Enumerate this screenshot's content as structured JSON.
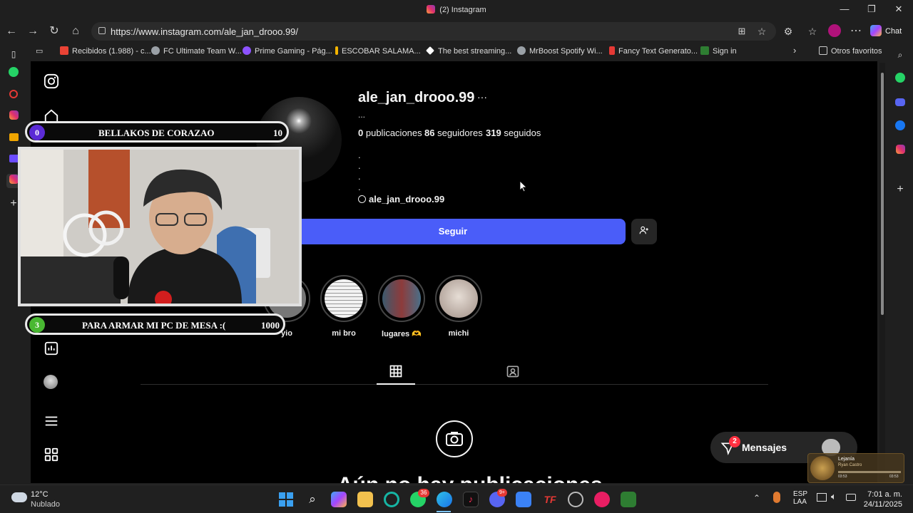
{
  "window": {
    "title": "(2) Instagram",
    "minimize": "—",
    "maximize": "❐",
    "close": "✕"
  },
  "browser": {
    "url": "https://www.instagram.com/ale_jan_drooo.99/",
    "chat_label": "Chat",
    "favorites_label": "Otros favoritos",
    "bookmarks": [
      {
        "label": "Recibidos (1.988) - c...",
        "color": "#ea4335"
      },
      {
        "label": "FC Ultimate Team W...",
        "color": "#9aa0a6"
      },
      {
        "label": "Prime Gaming - Pág...",
        "color": "#8c52ff"
      },
      {
        "label": "ESCOBAR SALAMA...",
        "color": "#f4b400"
      },
      {
        "label": "The best streaming...",
        "color": "#ffffff"
      },
      {
        "label": "MrBoost Spotify Wi...",
        "color": "#9aa0a6"
      },
      {
        "label": "Fancy Text Generato...",
        "color": "#e53935"
      },
      {
        "label": "Sign in",
        "color": "#2e7d32"
      }
    ]
  },
  "profile": {
    "username": "ale_jan_drooo.99",
    "more": "···",
    "name_placeholder": "...",
    "posts_count": "0",
    "posts_label": "publicaciones",
    "followers_count": "86",
    "followers_label": "seguidores",
    "following_count": "319",
    "following_label": "seguidos",
    "bio_lines": [
      ".",
      ".",
      ".",
      "."
    ],
    "threads_handle": "ale_jan_drooo.99",
    "follow_button": "Seguir",
    "highlights": [
      {
        "label": "yio",
        "color": "#777"
      },
      {
        "label": "mi bro",
        "color": "#e8e8e8"
      },
      {
        "label": "lugares 🫶",
        "color": "#5b6e7a"
      },
      {
        "label": "michi",
        "color": "#b9a9a0"
      }
    ],
    "empty_title": "Aún no hay publicaciones"
  },
  "messages": {
    "label": "Mensajes",
    "badge": "2"
  },
  "overlay": {
    "goal1": {
      "num": "0",
      "text": "BELLAKOS DE CORAZAO",
      "target": "10"
    },
    "goal2": {
      "num": "3",
      "text": "PARA ARMAR MI PC DE MESA :(",
      "target": "1000"
    }
  },
  "music_widget": {
    "title": "Lejanía",
    "artist": "Ryan Castro",
    "elapsed": "03:53",
    "total": "03:53"
  },
  "taskbar": {
    "weather_temp": "12°C",
    "weather_desc": "Nublado",
    "whatsapp_badge": "36",
    "discord_badge": "9+",
    "lang_line1": "ESP",
    "lang_line2": "LAA",
    "time": "7:01 a. m.",
    "date": "24/11/2025"
  }
}
